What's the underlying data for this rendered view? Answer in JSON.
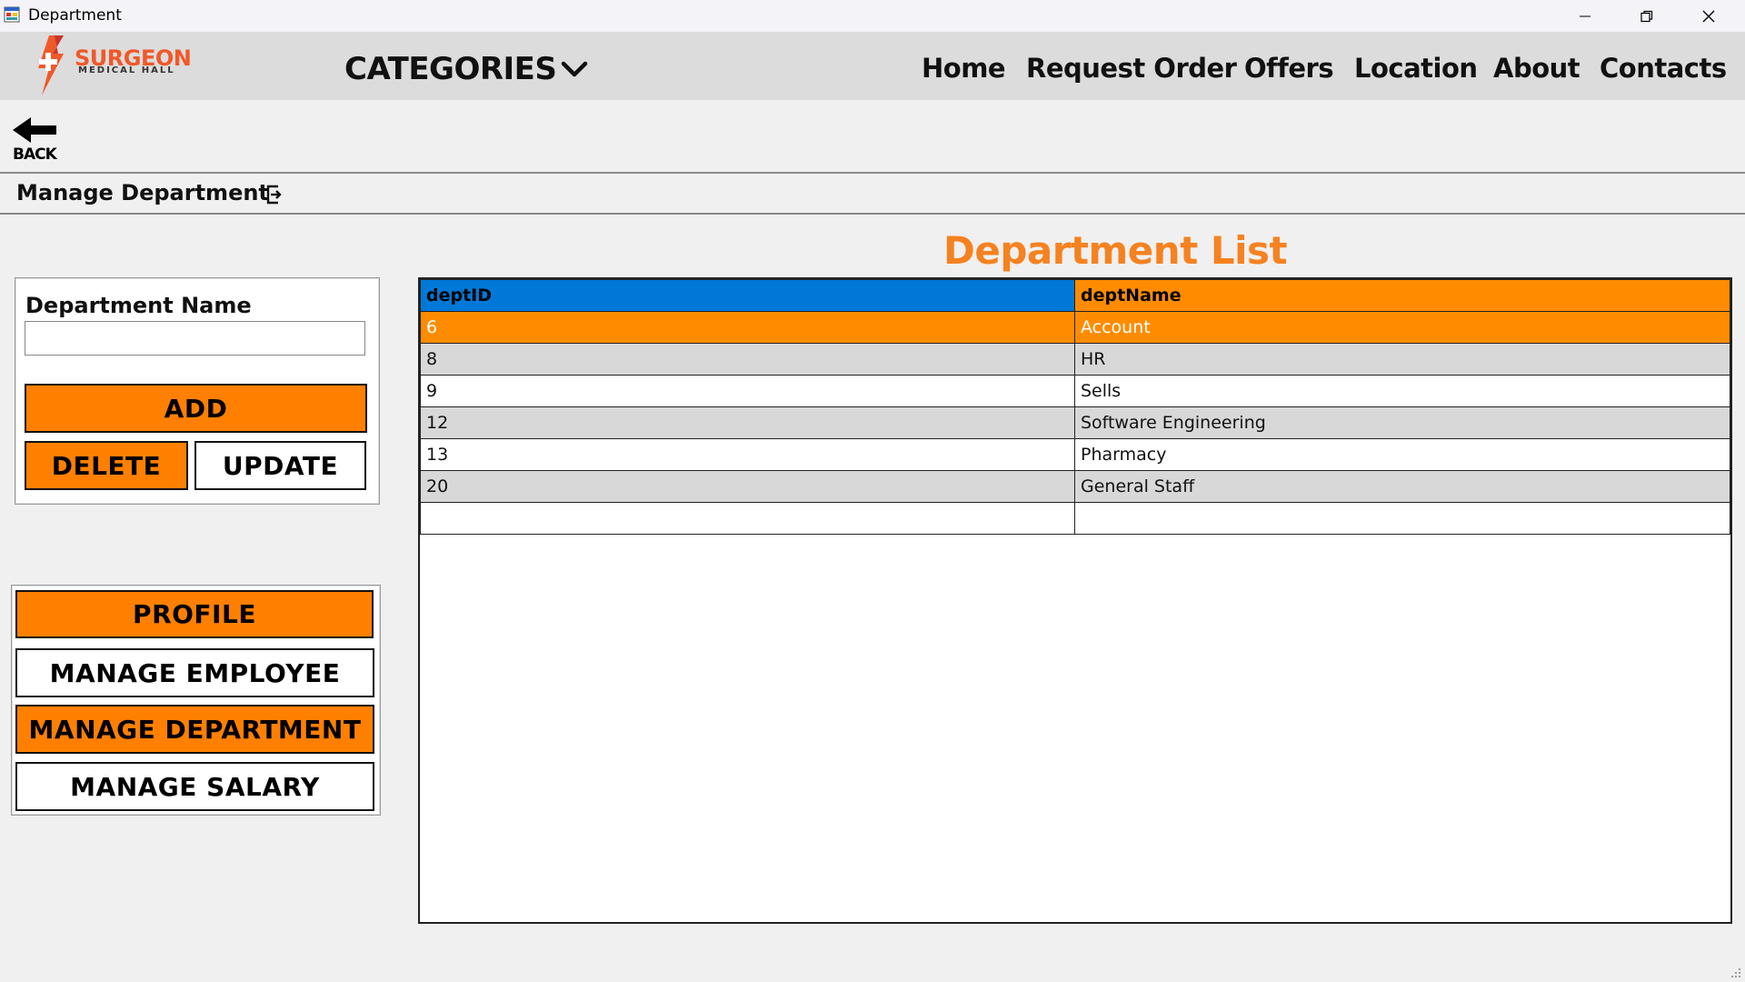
{
  "window": {
    "title": "Department",
    "controls": [
      "minimize-icon",
      "restore-icon",
      "close-icon"
    ]
  },
  "header": {
    "logo": {
      "name": "SURGEON",
      "subtitle": "MEDICAL HALL"
    },
    "categories_label": "CATEGORIES",
    "nav": [
      "Home",
      "Request Order",
      "Offers",
      "Location",
      "About",
      "Contacts"
    ]
  },
  "back": {
    "label": "BACK"
  },
  "section": {
    "title": "Manage Department"
  },
  "form": {
    "label": "Department Name",
    "value": "",
    "placeholder": "",
    "add_label": "ADD",
    "delete_label": "DELETE",
    "update_label": "UPDATE"
  },
  "menu": {
    "profile": "PROFILE",
    "manage_employee": "MANAGE EMPLOYEE",
    "manage_department": "MANAGE DEPARTMENT",
    "manage_salary": "MANAGE SALARY"
  },
  "list": {
    "title": "Department List",
    "columns": [
      "deptID",
      "deptName"
    ],
    "rows": [
      [
        "6",
        "Account"
      ],
      [
        "8",
        "HR"
      ],
      [
        "9",
        "Sells"
      ],
      [
        "12",
        "Software Engineering"
      ],
      [
        "13",
        "Pharmacy"
      ],
      [
        "20",
        "General Staff"
      ],
      [
        "",
        ""
      ]
    ],
    "selected_row": 0
  },
  "colors": {
    "accent_orange": "#ff8000",
    "title_orange": "#f58220",
    "header_blue": "#0078d7",
    "logo_red": "#f0592a",
    "header_bg": "#dcdcdc"
  }
}
